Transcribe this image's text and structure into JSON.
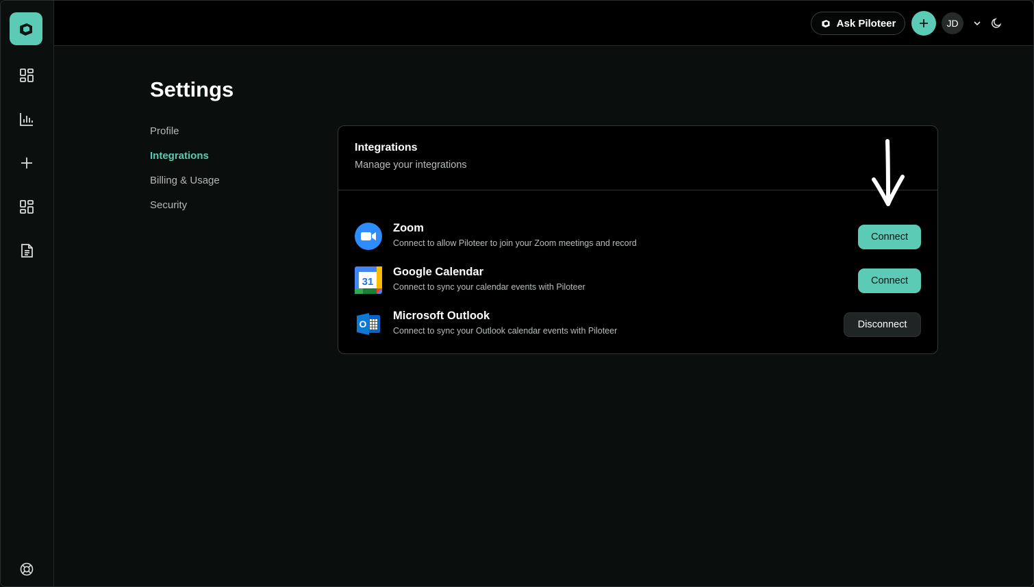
{
  "header": {
    "ask_label": "Ask Piloteer",
    "avatar_initials": "JD"
  },
  "sidebar": {
    "icons": [
      "dashboard-icon",
      "chart-icon",
      "plus-icon",
      "grid-icon",
      "document-icon",
      "help-lifebuoy-icon"
    ]
  },
  "page": {
    "title": "Settings"
  },
  "settings_nav": [
    {
      "label": "Profile",
      "active": false
    },
    {
      "label": "Integrations",
      "active": true
    },
    {
      "label": "Billing & Usage",
      "active": false
    },
    {
      "label": "Security",
      "active": false
    }
  ],
  "card": {
    "title": "Integrations",
    "subtitle": "Manage your integrations"
  },
  "integrations": [
    {
      "name": "Zoom",
      "description": "Connect to allow Piloteer to join your Zoom meetings and record",
      "action": "Connect",
      "icon": "zoom-icon"
    },
    {
      "name": "Google Calendar",
      "description": "Connect to sync your calendar events with Piloteer",
      "action": "Connect",
      "icon": "google-calendar-icon",
      "icon_text": "31"
    },
    {
      "name": "Microsoft Outlook",
      "description": "Connect to sync your Outlook calendar events with Piloteer",
      "action": "Disconnect",
      "icon": "outlook-icon",
      "icon_text": "O"
    }
  ],
  "colors": {
    "accent": "#5ccbb6",
    "background": "#0a0e0d",
    "card": "#000000"
  }
}
